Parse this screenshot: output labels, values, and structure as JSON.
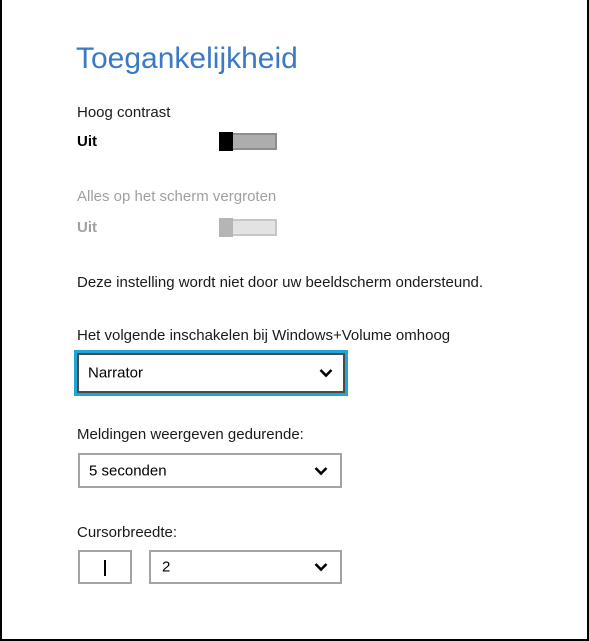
{
  "page": {
    "title": "Toegankelijkheid"
  },
  "high_contrast": {
    "label": "Hoog contrast",
    "value": "Uit",
    "on": false
  },
  "magnify": {
    "label": "Alles op het scherm vergroten",
    "value": "Uit",
    "on": false,
    "enabled": false
  },
  "note": {
    "text": "Deze instelling wordt niet door uw beeldscherm ondersteund."
  },
  "win_volume": {
    "label": "Het volgende inschakelen bij Windows+Volume omhoog",
    "selected": "Narrator"
  },
  "notifications": {
    "label": "Meldingen weergeven gedurende:",
    "selected": "5 seconden"
  },
  "cursor_width": {
    "label": "Cursorbreedte:",
    "selected": "2"
  },
  "colors": {
    "accent": "#3a79c5",
    "focus_border": "#1ea6d8",
    "disabled_text": "#a0a0a0"
  },
  "icons": {
    "dropdown": "chevron-down-icon",
    "cursor_preview": "text-cursor-icon"
  }
}
